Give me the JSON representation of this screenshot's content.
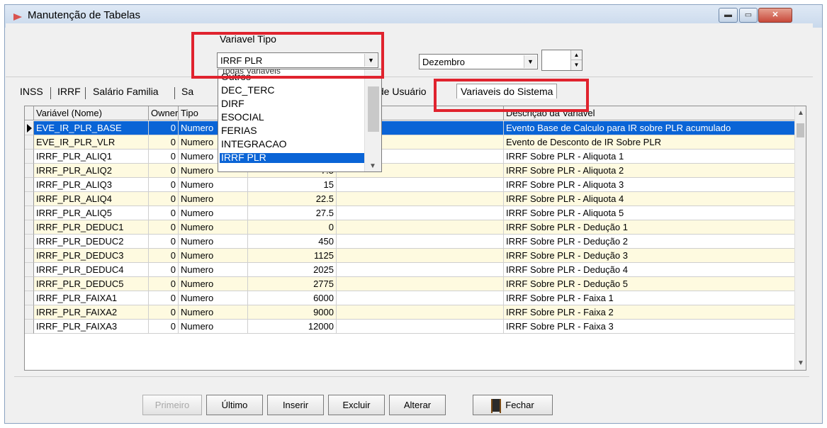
{
  "window": {
    "title": "Manutenção de Tabelas",
    "controls": {
      "minimize": "▬",
      "maximize": "▭",
      "close": "✕"
    }
  },
  "toolbar": {
    "variavel_tipo_label": "Variavel Tipo",
    "variavel_tipo_value": "IRRF PLR",
    "mes_value": "Dezembro",
    "ano_value": ""
  },
  "dropdown": {
    "items": [
      "Todas Variaveis",
      "Outros",
      "DEC_TERC",
      "DIRF",
      "ESOCIAL",
      "FERIAS",
      "INTEGRACAO",
      "IRRF PLR"
    ],
    "selected": "IRRF PLR"
  },
  "tabs": [
    "INSS",
    "IRRF",
    "Salário Familia",
    "Sa",
    "s de Usuário",
    "Variaveis do Sistema"
  ],
  "grid": {
    "columns": [
      "Variável (Nome)",
      "Owner",
      "Tipo",
      "",
      "o",
      "Descrição da Variavel"
    ],
    "rows": [
      {
        "nome": "EVE_IR_PLR_BASE",
        "owner": "0",
        "tipo": "Numero",
        "valor": "",
        "descricao": "Evento Base de Calculo para IR sobre PLR acumulado"
      },
      {
        "nome": "EVE_IR_PLR_VLR",
        "owner": "0",
        "tipo": "Numero",
        "valor": "",
        "descricao": "Evento de Desconto de IR Sobre PLR"
      },
      {
        "nome": "IRRF_PLR_ALIQ1",
        "owner": "0",
        "tipo": "Numero",
        "valor": "",
        "descricao": "IRRF Sobre PLR - Aliquota 1"
      },
      {
        "nome": "IRRF_PLR_ALIQ2",
        "owner": "0",
        "tipo": "Numero",
        "valor": "7.5",
        "descricao": "IRRF Sobre PLR - Aliquota 2"
      },
      {
        "nome": "IRRF_PLR_ALIQ3",
        "owner": "0",
        "tipo": "Numero",
        "valor": "15",
        "descricao": "IRRF Sobre PLR - Aliquota 3"
      },
      {
        "nome": "IRRF_PLR_ALIQ4",
        "owner": "0",
        "tipo": "Numero",
        "valor": "22.5",
        "descricao": "IRRF Sobre PLR - Aliquota 4"
      },
      {
        "nome": "IRRF_PLR_ALIQ5",
        "owner": "0",
        "tipo": "Numero",
        "valor": "27.5",
        "descricao": "IRRF Sobre PLR - Aliquota 5"
      },
      {
        "nome": "IRRF_PLR_DEDUC1",
        "owner": "0",
        "tipo": "Numero",
        "valor": "0",
        "descricao": "IRRF Sobre PLR - Dedução 1"
      },
      {
        "nome": "IRRF_PLR_DEDUC2",
        "owner": "0",
        "tipo": "Numero",
        "valor": "450",
        "descricao": "IRRF Sobre PLR - Dedução 2"
      },
      {
        "nome": "IRRF_PLR_DEDUC3",
        "owner": "0",
        "tipo": "Numero",
        "valor": "1125",
        "descricao": "IRRF Sobre PLR - Dedução 3"
      },
      {
        "nome": "IRRF_PLR_DEDUC4",
        "owner": "0",
        "tipo": "Numero",
        "valor": "2025",
        "descricao": "IRRF Sobre PLR - Dedução 4"
      },
      {
        "nome": "IRRF_PLR_DEDUC5",
        "owner": "0",
        "tipo": "Numero",
        "valor": "2775",
        "descricao": "IRRF Sobre PLR - Dedução 5"
      },
      {
        "nome": "IRRF_PLR_FAIXA1",
        "owner": "0",
        "tipo": "Numero",
        "valor": "6000",
        "descricao": "IRRF Sobre PLR - Faixa 1"
      },
      {
        "nome": "IRRF_PLR_FAIXA2",
        "owner": "0",
        "tipo": "Numero",
        "valor": "9000",
        "descricao": "IRRF Sobre PLR - Faixa 2"
      },
      {
        "nome": "IRRF_PLR_FAIXA3",
        "owner": "0",
        "tipo": "Numero",
        "valor": "12000",
        "descricao": "IRRF Sobre PLR - Faixa 3"
      }
    ]
  },
  "buttons": {
    "primeiro": "Primeiro",
    "ultimo": "Último",
    "inserir": "Inserir",
    "excluir": "Excluir",
    "alterar": "Alterar",
    "fechar": "Fechar"
  },
  "colors": {
    "selection": "#0a64d6",
    "highlight_box": "#e0232e",
    "row_alt": "#fefae0"
  }
}
